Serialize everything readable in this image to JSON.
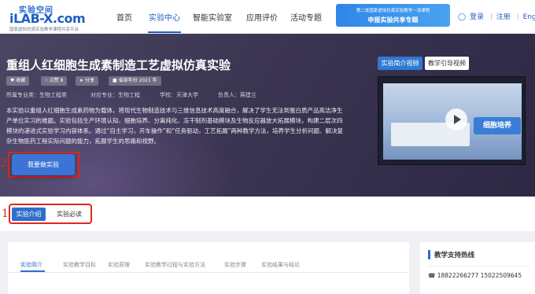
{
  "nav": {
    "logo_cn": "实验空间",
    "logo_en": "iLAB-X.com",
    "logo_sub": "国家虚拟仿真实验教学课程共享平台",
    "items": [
      "首页",
      "实验中心",
      "智能实验室",
      "应用评价",
      "活动专题"
    ],
    "banner_line1": "第二批国家虚拟仿真实验教学一流课程",
    "banner_line2": "申报实验共享专题",
    "login": "登录",
    "register": "注册",
    "english": "English",
    "accent": "#1f5fc2"
  },
  "hero": {
    "title": "重组人红细胞生成素制造工艺虚拟仿真实验",
    "pills": [
      "收藏",
      "点赞 8",
      "分享",
      "省部年份 2021 年"
    ],
    "meta": [
      "所属专业类：生物工程类",
      "对应专业：生物工程",
      "学校：天津大学",
      "负责人：蒋建兰"
    ],
    "description": "本实验以重组人红细胞生成素药物为载体，将现代生物制造技术与三维信息技术高度融合，解决了学生无法到蛋白质产品高洁净生产单位实习的难题。实验包括生产环境认知、细胞培养、分离纯化、冻干制剂基础模块及生物反应器放大拓展模块，构建二层次四模块的递进式实验学习内容体系。通过“自主学习，开车操作”和“任务驱动，工艺拓展”两种教学方法，培养学生分析问题、解决复杂生物医药工程实际问题的能力，拓展学生的思路和视野。",
    "do_button": "我要做实验",
    "annotation_2": "2",
    "video_tabs": [
      "实验简介视频",
      "教学引导视频"
    ],
    "video_tag": "细胞培养"
  },
  "subtabs": {
    "active": "实验介绍",
    "inactive": "实验必读",
    "annotation_1": "1"
  },
  "content": {
    "tabs": [
      "实验简介",
      "实验教学目标",
      "实验原理",
      "实验教学过程与实验方法",
      "实验步骤",
      "实验结果与结论"
    ]
  },
  "side": {
    "heading": "教学支持热线",
    "phones": "18822266277  15022509645"
  }
}
